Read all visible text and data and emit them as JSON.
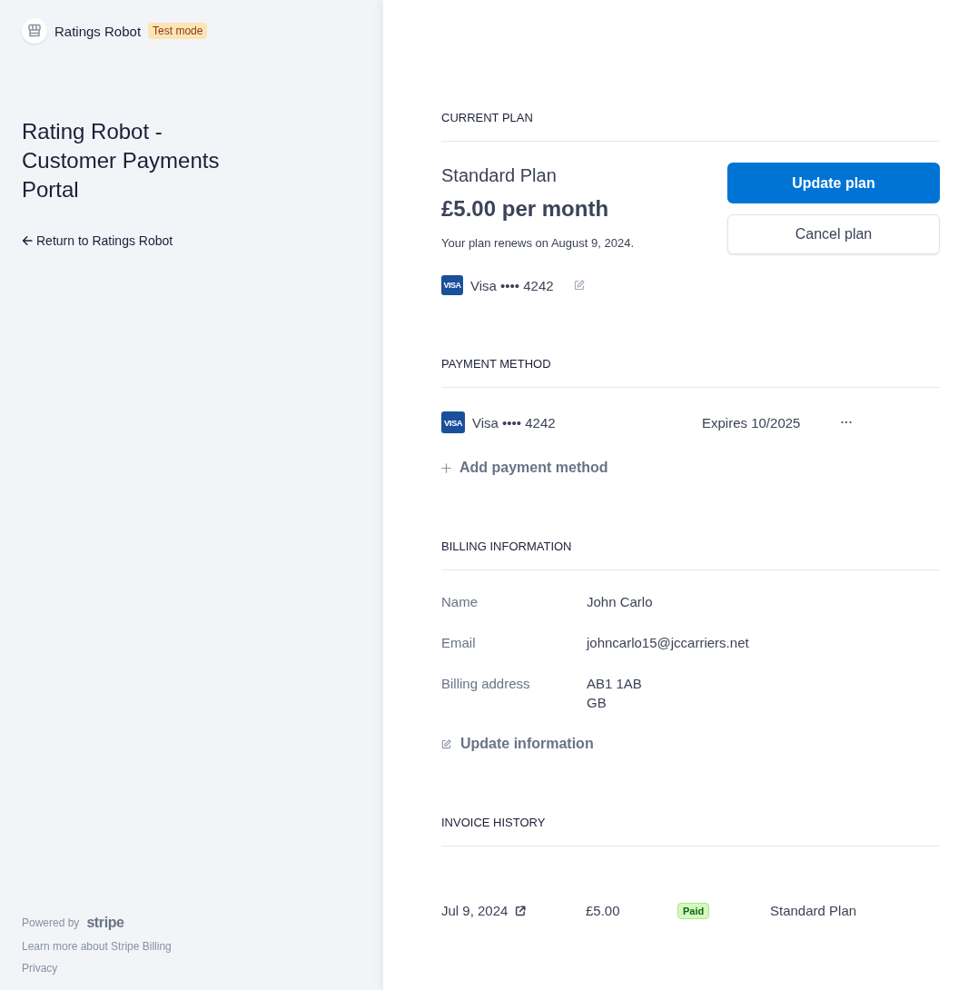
{
  "sidebar": {
    "business": {
      "name": "Ratings Robot",
      "badge": "Test mode"
    },
    "title": "Rating Robot - Customer Payments Portal",
    "return_link": "Return to Ratings Robot",
    "footer": {
      "powered_by": "Powered by",
      "logo": "stripe",
      "links": [
        "Learn more about Stripe Billing",
        "Privacy"
      ]
    }
  },
  "current_plan": {
    "heading": "CURRENT PLAN",
    "plan_name": "Standard Plan",
    "price": "£5.00 per month",
    "renewal": "Your plan renews on August 9, 2024.",
    "card": {
      "brand_mark": "VISA",
      "label": "Visa •••• 4242"
    },
    "buttons": [
      {
        "label": "Update plan",
        "kind": "primary"
      },
      {
        "label": "Cancel plan",
        "kind": "secondary"
      }
    ]
  },
  "payment_method": {
    "heading": "PAYMENT METHOD",
    "methods": [
      {
        "brand_mark": "VISA",
        "label": "Visa •••• 4242",
        "expiry": "Expires 10/2025"
      }
    ],
    "add_link": "Add payment method"
  },
  "billing_information": {
    "heading": "BILLING INFORMATION",
    "fields": [
      {
        "label": "Name",
        "lines": [
          "John Carlo"
        ]
      },
      {
        "label": "Email",
        "lines": [
          "johncarlo15@jccarriers.net"
        ]
      },
      {
        "label": "Billing address",
        "lines": [
          "AB1 1AB",
          "GB"
        ]
      }
    ],
    "update_link": "Update information"
  },
  "invoice_history": {
    "heading": "INVOICE HISTORY",
    "invoices": [
      {
        "date": "Jul 9, 2024",
        "amount": "£5.00",
        "status": "Paid",
        "plan": "Standard Plan"
      }
    ]
  }
}
